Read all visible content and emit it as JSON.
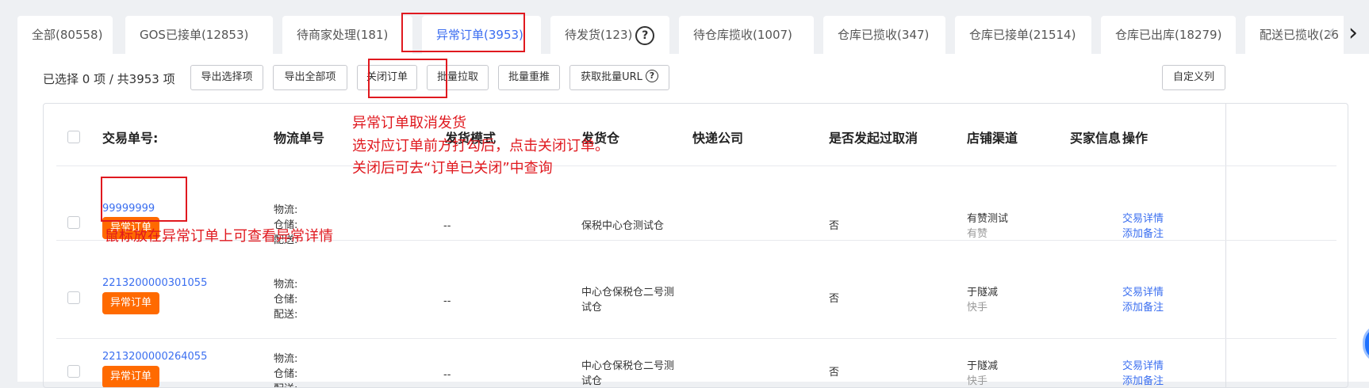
{
  "tabs": [
    {
      "label": "全部(80558)"
    },
    {
      "label": "GOS已接单(12853)"
    },
    {
      "label": "待商家处理(181)"
    },
    {
      "label": "异常订单(3953)"
    },
    {
      "label": "待发货(123)"
    },
    {
      "label": "待仓库揽收(1007)"
    },
    {
      "label": "仓库已揽收(347)"
    },
    {
      "label": "仓库已接单(21514)"
    },
    {
      "label": "仓库已出库(18279)"
    },
    {
      "label": "配送已揽收(26"
    }
  ],
  "help_glyph": "?",
  "nav": {
    "prev": "‹",
    "next": "›"
  },
  "toolbar": {
    "count_text": "已选择 0 项 / 共3953 项",
    "export_selected": "导出选择项",
    "export_all": "导出全部项",
    "close_order": "关闭订单",
    "batch_pull": "批量拉取",
    "batch_repush": "批量重推",
    "get_batch_url": "获取批量URL",
    "custom_columns": "自定义列"
  },
  "columns": {
    "trade_no": "交易单号:",
    "logistics_no": "物流单号",
    "ship_mode": "发货模式",
    "warehouse": "发货仓",
    "courier": "快递公司",
    "cancel_initiated": "是否发起过取消",
    "channel": "店铺渠道",
    "buyer": "买家信息",
    "actions": "操作"
  },
  "logistics_labels": {
    "logistics": "物流:",
    "warehouse": "仓储:",
    "delivery": "配送:"
  },
  "rows": [
    {
      "trade_no": "99999999",
      "badge": "异常订单",
      "ship_mode": "--",
      "warehouse": "保税中心仓测试仓",
      "cancel": "否",
      "shop": "有赞测试",
      "platform": "有赞",
      "action_detail": "交易详情",
      "action_note": "添加备注"
    },
    {
      "trade_no": "2213200000301055",
      "badge": "异常订单",
      "ship_mode": "--",
      "warehouse": "中心仓保税仓二号测试仓",
      "cancel": "否",
      "shop": "于隧减",
      "platform": "快手",
      "action_detail": "交易详情",
      "action_note": "添加备注"
    },
    {
      "trade_no": "2213200000264055",
      "badge": "异常订单",
      "ship_mode": "--",
      "warehouse": "中心仓保税仓二号测试仓",
      "cancel": "否",
      "shop": "于隧减",
      "platform": "快手",
      "action_detail": "交易详情",
      "action_note": "添加备注"
    }
  ],
  "annotations": {
    "title": "异常订单取消发货",
    "line1": "选对应订单前方打勾后，点击关闭订单。",
    "line2": "关闭后可去“订单已关闭”中查询",
    "hover_tip": "鼠标放在异常订单上可查看异常详情"
  },
  "colors": {
    "accent": "#3b6ff0",
    "badge": "#ff6a00",
    "annotation": "#e0191f"
  }
}
